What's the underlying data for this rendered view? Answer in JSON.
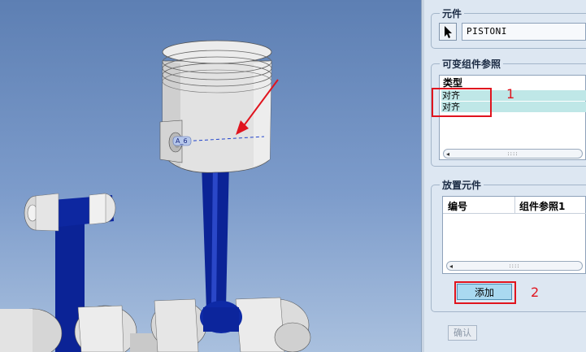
{
  "viewport": {
    "datum_label": "A_6"
  },
  "panel": {
    "component_section": {
      "title": "元件",
      "component_name": "PISTONI"
    },
    "variable_refs_section": {
      "title": "可变组件参照",
      "column_header": "类型",
      "rows": [
        "对齐",
        "对齐"
      ]
    },
    "placement_section": {
      "title": "放置元件",
      "columns": [
        "编号",
        "组件参照1"
      ],
      "add_button": "添加",
      "confirm_button": "确认"
    }
  },
  "annotations": {
    "marker_1": "1",
    "marker_2": "2"
  },
  "colors": {
    "highlight_row": "#bfe7e7",
    "annotation_red": "#e0141e",
    "rod_blue": "#0a1f8f"
  }
}
